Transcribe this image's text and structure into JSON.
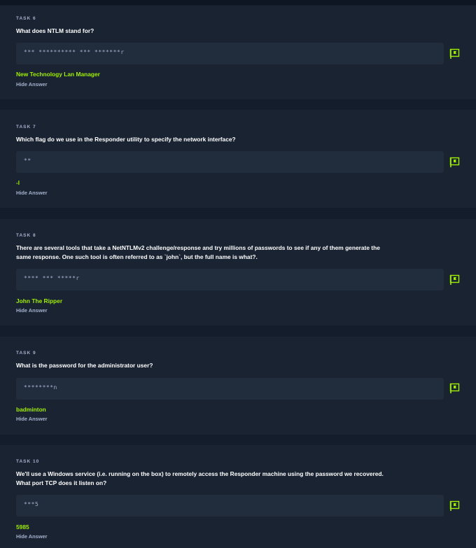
{
  "colors": {
    "accent": "#9fef00",
    "background": "#141d2b",
    "card": "#1a2332",
    "input": "#212c3d",
    "muted": "#a4b1cd"
  },
  "tasks": [
    {
      "label": "TASK 6",
      "question": "What does NTLM stand for?",
      "placeholder": "*** ********** *** *******r",
      "answer": "New Technology Lan Manager",
      "hide_label": "Hide Answer",
      "flag_icon": "flag-icon"
    },
    {
      "label": "TASK 7",
      "question": "Which flag do we use in the Responder utility to specify the network interface?",
      "placeholder": "**",
      "answer": "-I",
      "hide_label": "Hide Answer",
      "flag_icon": "flag-icon"
    },
    {
      "label": "TASK 8",
      "question": "There are several tools that take a NetNTLMv2 challenge/response and try millions of passwords to see if any of them generate the same response. One such tool is often referred to as `john`, but the full name is what?.",
      "placeholder": "**** *** *****r",
      "answer": "John The Ripper",
      "hide_label": "Hide Answer",
      "flag_icon": "flag-icon"
    },
    {
      "label": "TASK 9",
      "question": "What is the password for the administrator user?",
      "placeholder": "********n",
      "answer": "badminton",
      "hide_label": "Hide Answer",
      "flag_icon": "flag-icon"
    },
    {
      "label": "TASK 10",
      "question": "We'll use a Windows service (i.e. running on the box) to remotely access the Responder machine using the password we recovered. What port TCP does it listen on?",
      "placeholder": "***5",
      "answer": "5985",
      "hide_label": "Hide Answer",
      "flag_icon": "flag-icon"
    }
  ]
}
